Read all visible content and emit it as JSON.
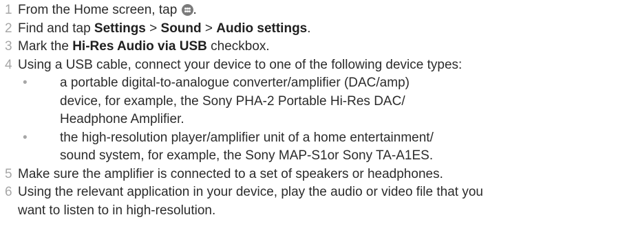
{
  "steps": [
    {
      "num": "1",
      "parts": {
        "a": "From the Home screen, tap ",
        "icon": "apps-icon",
        "b": "."
      }
    },
    {
      "num": "2",
      "parts": {
        "a": "Find and tap ",
        "b1": "Settings",
        "s1": " > ",
        "b2": "Sound",
        "s2": " > ",
        "b3": "Audio settings",
        "end": "."
      }
    },
    {
      "num": "3",
      "parts": {
        "a": "Mark the ",
        "b1": "Hi-Res Audio via USB",
        "end": " checkbox."
      }
    },
    {
      "num": "4",
      "text": "Using a USB cable, connect your device to one of the following device types:",
      "bullets": [
        {
          "marker": "•",
          "lines": [
            "a portable digital-to-analogue converter/amplifier (DAC/amp)",
            "device, for example, the Sony PHA-2 Portable Hi-Res DAC/",
            "Headphone Amplifier."
          ]
        },
        {
          "marker": "•",
          "lines": [
            "the high-resolution player/amplifier unit of a home entertainment/",
            "sound system, for example, the Sony MAP-S1or Sony TA-A1ES."
          ]
        }
      ]
    },
    {
      "num": "5",
      "text": "Make sure the amplifier is connected to a set of speakers or headphones."
    },
    {
      "num": "6",
      "lines": [
        "Using the relevant application in your device, play the audio or video file that you",
        "want to listen to in high-resolution."
      ]
    }
  ]
}
